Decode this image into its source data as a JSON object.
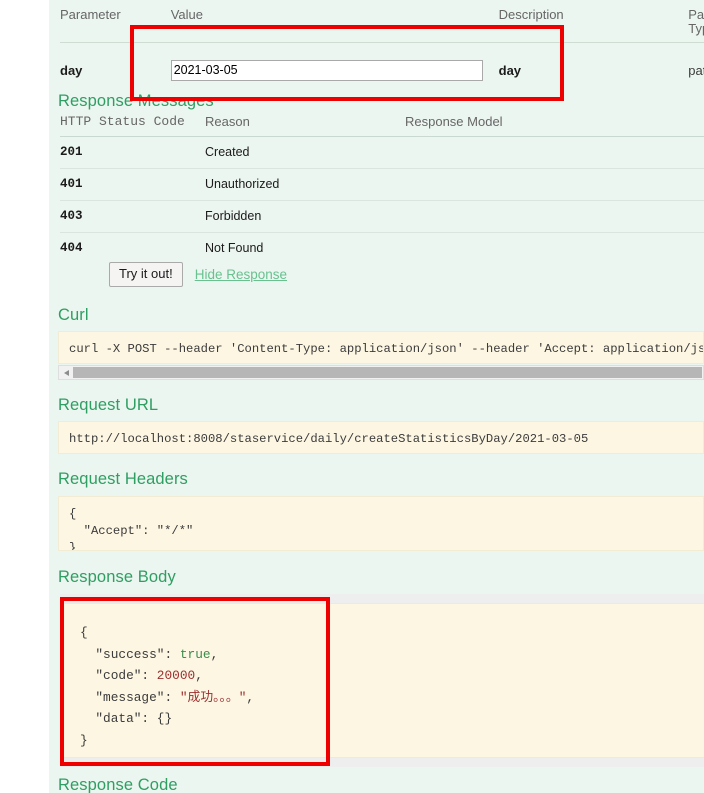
{
  "parameters": {
    "headers": {
      "parameter": "Parameter",
      "value": "Value",
      "description": "Description",
      "parameter_type_line1": "Par",
      "parameter_type_line2": "Typ"
    },
    "rows": [
      {
        "name": "day",
        "value": "2021-03-05",
        "description": "day",
        "parameter_type": "pat"
      }
    ]
  },
  "response_messages": {
    "heading": "Response Messages",
    "headers": {
      "status_code": "HTTP Status Code",
      "reason": "Reason",
      "response_model": "Response Model"
    },
    "rows": [
      {
        "code": "201",
        "reason": "Created",
        "model": ""
      },
      {
        "code": "401",
        "reason": "Unauthorized",
        "model": ""
      },
      {
        "code": "403",
        "reason": "Forbidden",
        "model": ""
      },
      {
        "code": "404",
        "reason": "Not Found",
        "model": ""
      }
    ]
  },
  "actions": {
    "try_it_out": "Try it out!",
    "hide_response": "Hide Response"
  },
  "curl": {
    "heading": "Curl",
    "command": "curl -X POST --header 'Content-Type: application/json' --header 'Accept: application/json"
  },
  "request_url": {
    "heading": "Request URL",
    "url": "http://localhost:8008/staservice/daily/createStatisticsByDay/2021-03-05"
  },
  "request_headers": {
    "heading": "Request Headers",
    "body": "{\n  \"Accept\": \"*/*\"\n}"
  },
  "response_body": {
    "heading": "Response Body",
    "lines": {
      "open_brace": "{",
      "success_key": "  \"success\": ",
      "success_val": "true",
      "success_comma": ",",
      "code_key": "  \"code\": ",
      "code_val": "20000",
      "code_comma": ",",
      "message_key": "  \"message\": ",
      "message_val": "\"成功。。。\"",
      "message_comma": ",",
      "data_key": "  \"data\": ",
      "data_val": "{}",
      "close_brace": "}"
    }
  },
  "response_code": {
    "heading": "Response Code"
  },
  "colors": {
    "heading_green": "#2f9e63",
    "link_green": "#68c18f",
    "content_bg": "#ecf6f0",
    "code_bg": "#fcf6e3",
    "annotation_red": "#ee0000"
  }
}
